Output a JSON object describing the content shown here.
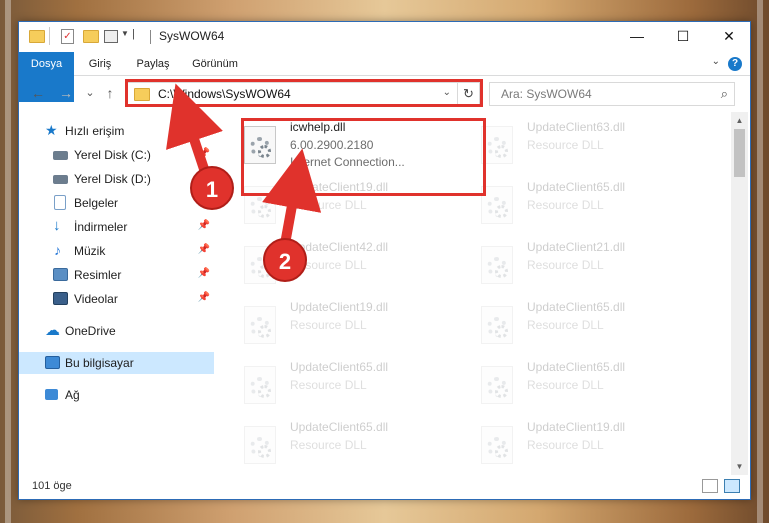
{
  "window": {
    "title": "SysWOW64",
    "controls": {
      "minimize": "—",
      "maximize": "☐",
      "close": "✕"
    }
  },
  "ribbon": {
    "tabs": [
      "Dosya",
      "Giriş",
      "Paylaş",
      "Görünüm"
    ],
    "help": "?"
  },
  "nav": {
    "back": "←",
    "forward": "→",
    "recent": "⌄",
    "up": "↑",
    "address": "C:\\Windows\\SysWOW64",
    "refresh": "↻",
    "search_placeholder": "Ara: SysWOW64",
    "search_icon": "⌕"
  },
  "sidebar": {
    "items": [
      {
        "label": "Hızlı erişim",
        "icon": "star-icon",
        "color": "#1979ca"
      },
      {
        "label": "Yerel Disk (C:)",
        "icon": "drive-icon",
        "color": "#5b6e80",
        "pinned": true
      },
      {
        "label": "Yerel Disk (D:)",
        "icon": "drive-icon",
        "color": "#5b6e80"
      },
      {
        "label": "Belgeler",
        "icon": "documents-icon",
        "color": "#7aa0c8",
        "pinned": true
      },
      {
        "label": "İndirmeler",
        "icon": "download-icon",
        "color": "#1979ca",
        "pinned": true
      },
      {
        "label": "Müzik",
        "icon": "music-icon",
        "color": "#2a7ad8",
        "pinned": true
      },
      {
        "label": "Resimler",
        "icon": "pictures-icon",
        "color": "#5b8fc4",
        "pinned": true
      },
      {
        "label": "Videolar",
        "icon": "videos-icon",
        "color": "#3a5f8a",
        "pinned": true
      },
      {
        "label": "OneDrive",
        "icon": "cloud-icon",
        "color": "#1979ca"
      },
      {
        "label": "Bu bilgisayar",
        "icon": "computer-icon",
        "color": "#3d8ad6",
        "selected": true
      },
      {
        "label": "Ağ",
        "icon": "network-icon",
        "color": "#3d8ad6"
      }
    ]
  },
  "files": [
    {
      "name": "icwhelp.dll",
      "line1": "6.00.2900.2180",
      "line2": "Internet Connection...",
      "highlighted": true
    },
    {
      "name": "UpdateClient63.dll",
      "line1": "Resource DLL"
    },
    {
      "name": "UpdateClient19.dll",
      "line1": "Resource DLL"
    },
    {
      "name": "UpdateClient65.dll",
      "line1": "Resource DLL"
    },
    {
      "name": "UpdateClient42.dll",
      "line1": "Resource DLL"
    },
    {
      "name": "UpdateClient21.dll",
      "line1": "Resource DLL"
    },
    {
      "name": "UpdateClient19.dll",
      "line1": "Resource DLL"
    },
    {
      "name": "UpdateClient65.dll",
      "line1": "Resource DLL"
    },
    {
      "name": "UpdateClient65.dll",
      "line1": "Resource DLL"
    },
    {
      "name": "UpdateClient65.dll",
      "line1": "Resource DLL"
    },
    {
      "name": "UpdateClient65.dll",
      "line1": "Resource DLL"
    },
    {
      "name": "UpdateClient19.dll",
      "line1": "Resource DLL"
    }
  ],
  "status": {
    "count": "101 öge"
  },
  "callouts": [
    "1",
    "2"
  ],
  "colors": {
    "accent": "#1979ca",
    "highlight": "#e0322c",
    "selected": "#cce8ff"
  }
}
